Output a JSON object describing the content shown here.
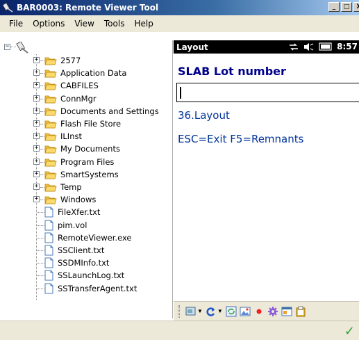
{
  "window": {
    "title": "BAR0003: Remote Viewer Tool",
    "minimize": "_",
    "maximize": "□",
    "close": "X"
  },
  "menu": [
    "File",
    "Options",
    "View",
    "Tools",
    "Help"
  ],
  "tree": {
    "folders": [
      "2577",
      "Application Data",
      "CABFILES",
      "ConnMgr",
      "Documents and Settings",
      "Flash File Store",
      "ILInst",
      "My Documents",
      "Program Files",
      "SmartSystems",
      "Temp",
      "Windows"
    ],
    "files": [
      "FileXfer.txt",
      "pim.vol",
      "RemoteViewer.exe",
      "SSClient.txt",
      "SSDMInfo.txt",
      "SSLaunchLog.txt",
      "SSTransferAgent.txt"
    ]
  },
  "device": {
    "header_title": "Layout",
    "time": "8:57",
    "heading": "SLAB Lot number",
    "input_value": "",
    "line1": "36.Layout",
    "line2": "ESC=Exit F5=Remnants"
  },
  "toolbar": {
    "icons": [
      "screen-capture-icon",
      "refresh-icon",
      "sync-icon",
      "picture-icon",
      "record-icon",
      "settings-icon",
      "window-icon",
      "clipboard-icon"
    ]
  },
  "status": {
    "icon": "check-icon",
    "check_glyph": "✓"
  },
  "colors": {
    "device_heading": "#00008b",
    "device_text": "#003399",
    "titlebar": "#0a246a",
    "check": "#2e9e2e"
  }
}
